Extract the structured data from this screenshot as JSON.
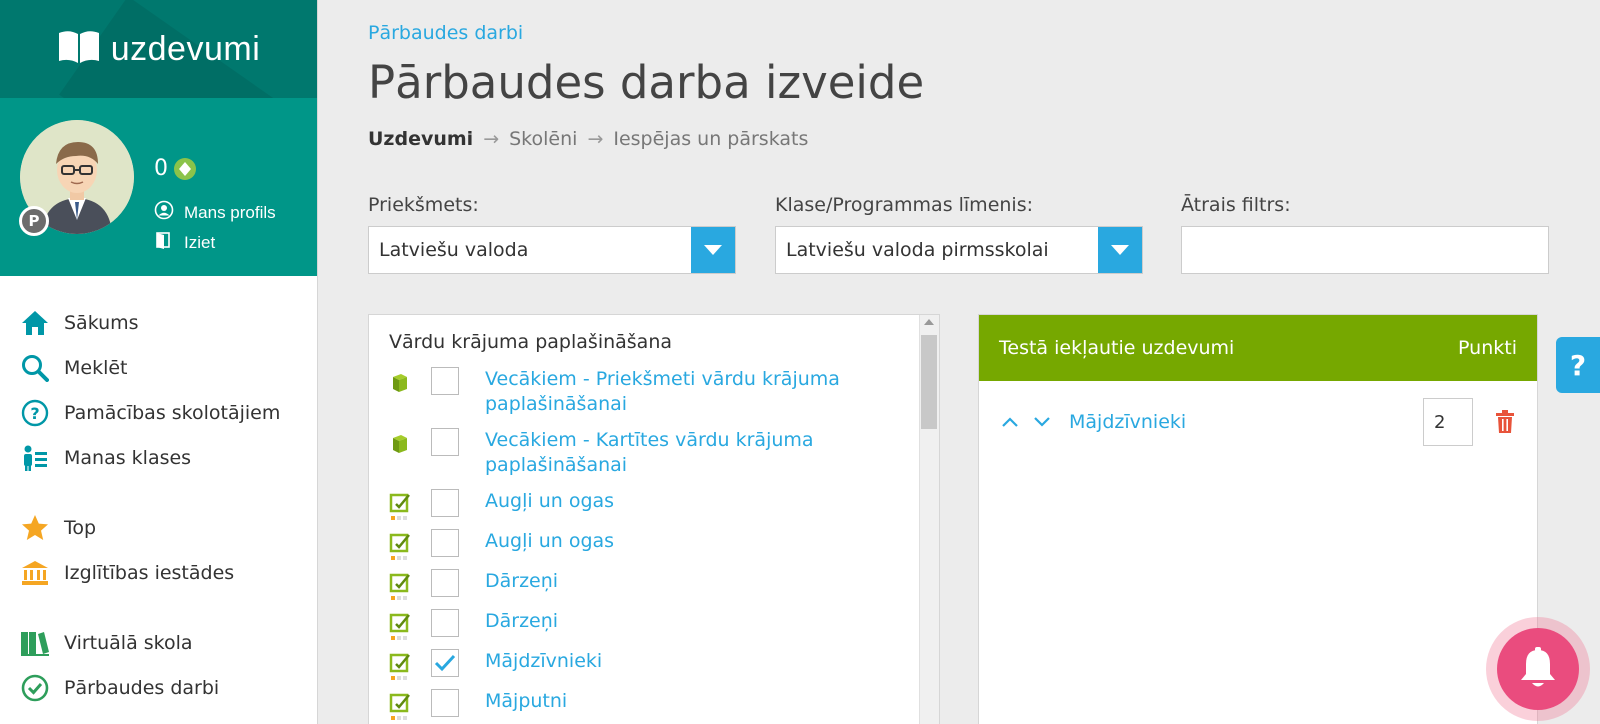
{
  "app": {
    "logo_text": "uzdevumi"
  },
  "profile": {
    "badge": "P",
    "points": "0",
    "links": [
      {
        "label": "Mans profils",
        "icon": "user-circle-icon"
      },
      {
        "label": "Iziet",
        "icon": "logout-icon"
      }
    ]
  },
  "nav": {
    "items": [
      {
        "label": "Sākums",
        "icon": "home-icon"
      },
      {
        "label": "Meklēt",
        "icon": "search-icon"
      },
      {
        "label": "Pamācības skolotājiem",
        "icon": "help-circle-icon"
      },
      {
        "label": "Manas klases",
        "icon": "class-list-icon"
      },
      {
        "label": "Top",
        "icon": "star-icon"
      },
      {
        "label": "Izglītības iestādes",
        "icon": "institution-icon"
      },
      {
        "label": "Virtuālā skola",
        "icon": "books-icon"
      },
      {
        "label": "Pārbaudes darbi",
        "icon": "check-circle-icon"
      }
    ]
  },
  "header": {
    "breadcrumb": "Pārbaudes darbi",
    "title": "Pārbaudes darba izveide",
    "steps": [
      "Uzdevumi",
      "Skolēni",
      "Iespējas un pārskats"
    ],
    "arrow": "→"
  },
  "filters": {
    "subject_label": "Priekšmets:",
    "subject_value": "Latviešu valoda",
    "level_label": "Klase/Programmas līmenis:",
    "level_value": "Latviešu valoda pirmsskolai",
    "quick_label": "Ātrais filtrs:",
    "quick_value": ""
  },
  "tasks": {
    "group_title": "Vārdu krājuma paplašināšana",
    "items": [
      {
        "label": "Vecākiem - Priekšmeti vārdu krājuma paplašināšanai",
        "type": "book-icon",
        "checked": false
      },
      {
        "label": "Vecākiem - Kartītes vārdu krājuma paplašināšanai",
        "type": "book-icon",
        "checked": false
      },
      {
        "label": "Augļi un ogas",
        "type": "exercise-icon",
        "checked": false
      },
      {
        "label": "Augļi un ogas",
        "type": "exercise-icon",
        "checked": false
      },
      {
        "label": "Dārzeņi",
        "type": "exercise-icon",
        "checked": false
      },
      {
        "label": "Dārzeņi",
        "type": "exercise-icon",
        "checked": false
      },
      {
        "label": "Mājdzīvnieki",
        "type": "exercise-icon",
        "checked": true
      },
      {
        "label": "Mājputni",
        "type": "exercise-icon",
        "checked": false
      }
    ]
  },
  "selected": {
    "header_title": "Testā iekļautie uzdevumi",
    "header_points": "Punkti",
    "items": [
      {
        "name": "Mājdzīvnieki",
        "points": "2"
      }
    ]
  },
  "help": {
    "label": "?"
  },
  "colors": {
    "teal_dark": "#00786e",
    "teal": "#009688",
    "blue": "#29a8e0",
    "green": "#76a800",
    "pink": "#ea4c7e"
  }
}
